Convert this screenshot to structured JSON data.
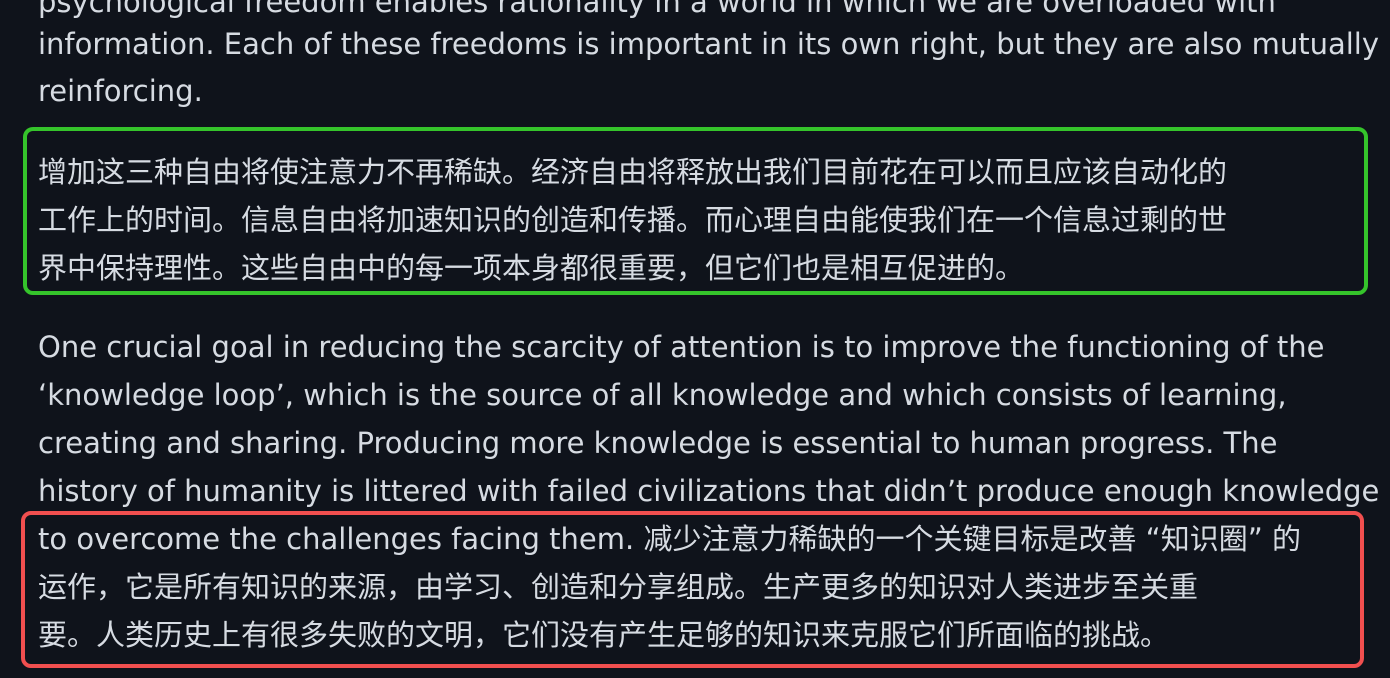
{
  "colors": {
    "background": "#0f131b",
    "text": "#d6dbe2",
    "green_highlight": "#35c42b",
    "red_highlight": "#f14f4f"
  },
  "paragraph_1": {
    "lines": [
      "psychological freedom enables rationality in a world in which we are overloaded with",
      "information. Each of these freedoms is important in its own right, but they are also mutually",
      "reinforcing."
    ]
  },
  "green_block": {
    "lines": [
      "增加这三种自由将使注意力不再稀缺。经济自由将释放出我们目前花在可以而且应该自动化的",
      "工作上的时间。信息自由将加速知识的创造和传播。而心理自由能使我们在一个信息过剩的世",
      "界中保持理性。这些自由中的每一项本身都很重要，但它们也是相互促进的。"
    ]
  },
  "paragraph_2": {
    "lines": [
      "One crucial goal in reducing the scarcity of attention is to improve the functioning of the",
      "‘knowledge loop’, which is the source of all knowledge and which consists of learning,",
      "creating and sharing. Producing more knowledge is essential to human progress. The",
      "history of humanity is littered with failed civilizations that didn’t produce enough knowledge"
    ]
  },
  "red_block": {
    "line_1_en": "to overcome the challenges facing them.",
    "line_1_zh": "减少注意力稀缺的一个关键目标是改善 “知识圈” 的",
    "lines": [
      "运作，它是所有知识的来源，由学习、创造和分享组成。生产更多的知识对人类进步至关重",
      "要。人类历史上有很多失败的文明，它们没有产生足够的知识来克服它们所面临的挑战。"
    ]
  }
}
